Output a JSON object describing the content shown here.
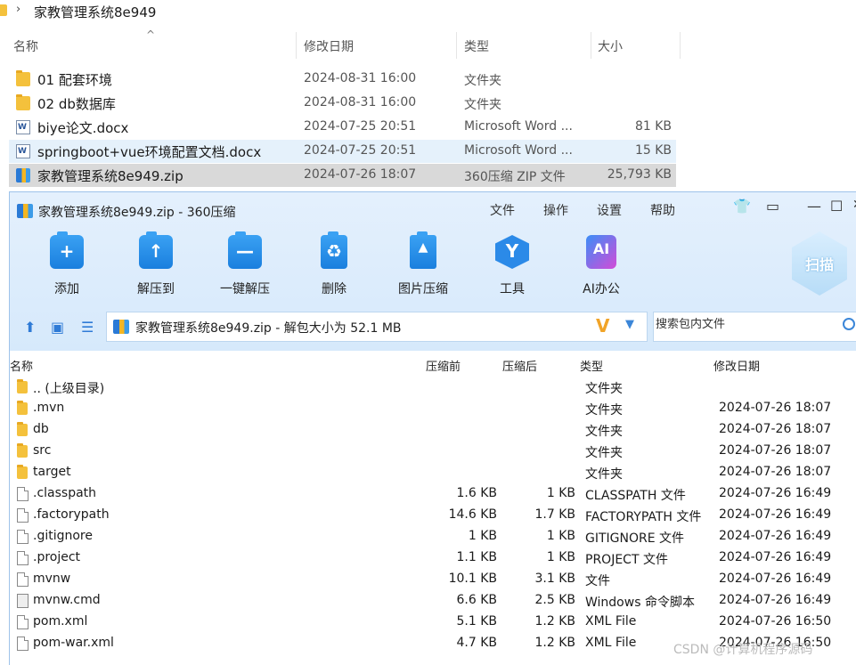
{
  "explorer": {
    "breadcrumb": "家教管理系统8e949",
    "columns": {
      "name": "名称",
      "modified": "修改日期",
      "type": "类型",
      "size": "大小"
    },
    "rows": [
      {
        "name": "01 配套环境",
        "modified": "2024-08-31 16:00",
        "type": "文件夹",
        "size": "",
        "icon": "folder-icon"
      },
      {
        "name": "02 db数据库",
        "modified": "2024-08-31 16:00",
        "type": "文件夹",
        "size": "",
        "icon": "folder-icon"
      },
      {
        "name": "biye论文.docx",
        "modified": "2024-07-25 20:51",
        "type": "Microsoft Word ...",
        "size": "81 KB",
        "icon": "word-doc-icon"
      },
      {
        "name": "springboot+vue环境配置文档.docx",
        "modified": "2024-07-25 20:51",
        "type": "Microsoft Word ...",
        "size": "15 KB",
        "icon": "word-doc-icon"
      },
      {
        "name": "家教管理系统8e949.zip",
        "modified": "2024-07-26 18:07",
        "type": "360压缩 ZIP 文件",
        "size": "25,793 KB",
        "icon": "zip-icon"
      }
    ]
  },
  "zip_window": {
    "title": "家教管理系统8e949.zip - 360压缩",
    "menu": [
      "文件",
      "操作",
      "设置",
      "帮助"
    ],
    "tools": [
      {
        "label": "添加",
        "glyph": "+"
      },
      {
        "label": "解压到",
        "glyph": "↑"
      },
      {
        "label": "一键解压",
        "glyph": "—"
      },
      {
        "label": "删除",
        "glyph": "♻"
      },
      {
        "label": "图片压缩",
        "glyph": "▲"
      },
      {
        "label": "工具",
        "glyph": "Y"
      },
      {
        "label": "AI办公",
        "glyph": "AI"
      }
    ],
    "scan_label": "扫描",
    "path": "家教管理系统8e949.zip - 解包大小为 52.1 MB",
    "search_placeholder": "搜索包内文件",
    "columns": {
      "name": "名称",
      "before": "压缩前",
      "after": "压缩后",
      "type": "类型",
      "modified": "修改日期"
    },
    "rows": [
      {
        "name": ".. (上级目录)",
        "before": "",
        "after": "",
        "type": "文件夹",
        "modified": "",
        "icon": "folder"
      },
      {
        "name": ".mvn",
        "before": "",
        "after": "",
        "type": "文件夹",
        "modified": "2024-07-26 18:07",
        "icon": "folder"
      },
      {
        "name": "db",
        "before": "",
        "after": "",
        "type": "文件夹",
        "modified": "2024-07-26 18:07",
        "icon": "folder"
      },
      {
        "name": "src",
        "before": "",
        "after": "",
        "type": "文件夹",
        "modified": "2024-07-26 18:07",
        "icon": "folder"
      },
      {
        "name": "target",
        "before": "",
        "after": "",
        "type": "文件夹",
        "modified": "2024-07-26 18:07",
        "icon": "folder"
      },
      {
        "name": ".classpath",
        "before": "1.6 KB",
        "after": "1 KB",
        "type": "CLASSPATH 文件",
        "modified": "2024-07-26 16:49",
        "icon": "file"
      },
      {
        "name": ".factorypath",
        "before": "14.6 KB",
        "after": "1.7 KB",
        "type": "FACTORYPATH 文件",
        "modified": "2024-07-26 16:49",
        "icon": "file"
      },
      {
        "name": ".gitignore",
        "before": "1 KB",
        "after": "1 KB",
        "type": "GITIGNORE 文件",
        "modified": "2024-07-26 16:49",
        "icon": "file"
      },
      {
        "name": ".project",
        "before": "1.1 KB",
        "after": "1 KB",
        "type": "PROJECT 文件",
        "modified": "2024-07-26 16:49",
        "icon": "file"
      },
      {
        "name": "mvnw",
        "before": "10.1 KB",
        "after": "3.1 KB",
        "type": "文件",
        "modified": "2024-07-26 16:49",
        "icon": "file"
      },
      {
        "name": "mvnw.cmd",
        "before": "6.6 KB",
        "after": "2.5 KB",
        "type": "Windows 命令脚本",
        "modified": "2024-07-26 16:49",
        "icon": "cmd"
      },
      {
        "name": "pom.xml",
        "before": "5.1 KB",
        "after": "1.2 KB",
        "type": "XML File",
        "modified": "2024-07-26 16:50",
        "icon": "file"
      },
      {
        "name": "pom-war.xml",
        "before": "4.7 KB",
        "after": "1.2 KB",
        "type": "XML File",
        "modified": "2024-07-26 16:50",
        "icon": "file"
      }
    ]
  },
  "watermark": "CSDN @计算机程序源码"
}
